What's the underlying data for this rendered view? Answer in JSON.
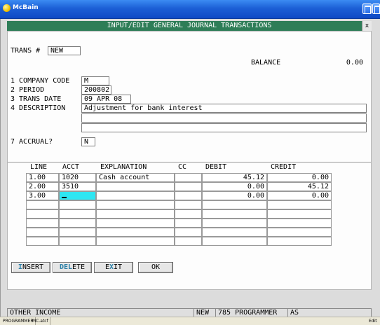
{
  "window": {
    "title": "McBain"
  },
  "screen": {
    "title": "INPUT/EDIT GENERAL JOURNAL TRANSACTIONS",
    "close_label": "x"
  },
  "form": {
    "trans_label": "TRANS #",
    "trans_value": "NEW",
    "balance_label": "BALANCE",
    "balance_value": "0.00",
    "company_code_label": "1 COMPANY CODE",
    "company_code_value": "M",
    "period_label": "2 PERIOD",
    "period_value": "200802",
    "trans_date_label": "3 TRANS DATE",
    "trans_date_value": "09 APR 08",
    "description_label": "4 DESCRIPTION",
    "description_value": "Adjustment for bank interest",
    "description_line2": "",
    "description_line3": "",
    "accrual_label": "7 ACCRUAL?",
    "accrual_value": "N"
  },
  "grid": {
    "columns": [
      "LINE",
      "ACCT",
      "EXPLANATION",
      "CC",
      "DEBIT",
      "CREDIT"
    ],
    "rows": [
      {
        "line": "1.00",
        "acct": "1020",
        "explanation": "Cash account",
        "cc": "",
        "debit": "45.12",
        "credit": "0.00"
      },
      {
        "line": "2.00",
        "acct": "3510",
        "explanation": "",
        "cc": "",
        "debit": "0.00",
        "credit": "45.12"
      },
      {
        "line": "3.00",
        "acct": "",
        "explanation": "",
        "cc": "",
        "debit": "0.00",
        "credit": "0.00"
      },
      {
        "line": "",
        "acct": "",
        "explanation": "",
        "cc": "",
        "debit": "",
        "credit": ""
      },
      {
        "line": "",
        "acct": "",
        "explanation": "",
        "cc": "",
        "debit": "",
        "credit": ""
      },
      {
        "line": "",
        "acct": "",
        "explanation": "",
        "cc": "",
        "debit": "",
        "credit": ""
      },
      {
        "line": "",
        "acct": "",
        "explanation": "",
        "cc": "",
        "debit": "",
        "credit": ""
      },
      {
        "line": "",
        "acct": "",
        "explanation": "",
        "cc": "",
        "debit": "",
        "credit": ""
      }
    ],
    "active_cell": "row 3 ACCT"
  },
  "buttons": {
    "insert": {
      "hotkey": "I",
      "rest": "NSERT"
    },
    "delete": {
      "hotkey": "DEL",
      "rest": "ETE"
    },
    "exit": {
      "prefix": "E",
      "hotkey": "X",
      "rest": "IT"
    },
    "ok": {
      "label": "OK"
    }
  },
  "status_bar": {
    "account_name": "OTHER INCOME",
    "mode": "NEW",
    "user": "785 PROGRAMMER",
    "initials": "AS"
  },
  "taskbar": {
    "item1": "PROGRAMMER",
    "item2": "MC.atcf",
    "right": "Edit"
  },
  "colors": {
    "header_bg": "#2e7d57",
    "active_cell": "#2ee6f2",
    "hotkey_text": "#2a7fa7",
    "titlebar": "#1c5fd6"
  }
}
